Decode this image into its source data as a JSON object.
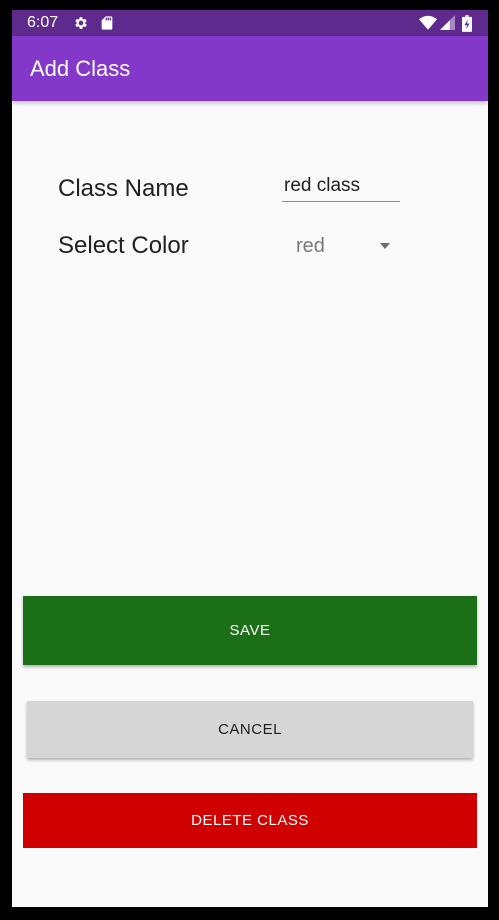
{
  "status_bar": {
    "time": "6:07",
    "icons": [
      "gear-icon",
      "sd-card-icon",
      "wifi-icon",
      "signal-icon",
      "battery-icon"
    ],
    "background": "#5e2a8e"
  },
  "app_bar": {
    "title": "Add Class",
    "background": "#8338c9"
  },
  "form": {
    "class_name_label": "Class Name",
    "class_name_value": "red class",
    "select_color_label": "Select Color",
    "select_color_value": "red"
  },
  "buttons": {
    "save_label": "SAVE",
    "save_color": "#1b7017",
    "cancel_label": "CANCEL",
    "cancel_color": "#d6d6d6",
    "delete_label": "DELETE CLASS",
    "delete_color": "#d10000"
  }
}
